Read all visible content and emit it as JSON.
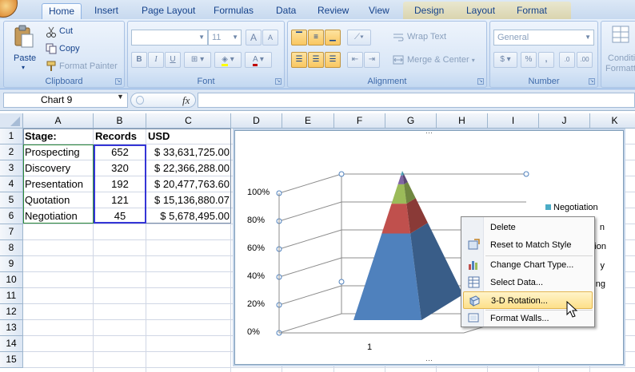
{
  "ribbon": {
    "tabs": [
      "Home",
      "Insert",
      "Page Layout",
      "Formulas",
      "Data",
      "Review",
      "View",
      "Design",
      "Layout",
      "Format"
    ],
    "clipboard": {
      "paste": "Paste",
      "cut": "Cut",
      "copy": "Copy",
      "format_painter": "Format Painter",
      "label": "Clipboard"
    },
    "font": {
      "size": "11",
      "label": "Font",
      "bold": "B",
      "italic": "I",
      "underline": "U",
      "grow": "A",
      "shrink": "A",
      "color_a": "A"
    },
    "alignment": {
      "wrap_text": "Wrap Text",
      "merge_center": "Merge & Center",
      "label": "Alignment"
    },
    "number": {
      "format": "General",
      "currency": "$",
      "percent": "%",
      "comma": ",",
      "label": "Number",
      "inc_dec": ".0",
      "dec_dec": ".00"
    },
    "styles": {
      "conditional": "Conditi",
      "format": "Formatt"
    }
  },
  "formula_bar": {
    "name_box": "Chart 9",
    "fx": "fx",
    "formula": ""
  },
  "columns": [
    "A",
    "B",
    "C",
    "D",
    "E",
    "F",
    "G",
    "H",
    "I",
    "J",
    "K"
  ],
  "rows": [
    "1",
    "2",
    "3",
    "4",
    "5",
    "6",
    "7",
    "8",
    "9",
    "10",
    "11",
    "12",
    "13",
    "14",
    "15"
  ],
  "table": {
    "headers": [
      "Stage:",
      "Records",
      "USD"
    ],
    "rows": [
      [
        "Prospecting",
        "652",
        "$ 33,631,725.00"
      ],
      [
        "Discovery",
        "320",
        "$ 22,366,288.00"
      ],
      [
        "Presentation",
        "192",
        "$ 20,477,763.60"
      ],
      [
        "Quotation",
        "121",
        "$ 15,136,880.07"
      ],
      [
        "Negotiation",
        "45",
        "$   5,678,495.00"
      ]
    ]
  },
  "chart_data": {
    "type": "bar",
    "subtype": "3d-pyramid-100-percent-stacked",
    "categories": [
      "1"
    ],
    "y_ticks": [
      "0%",
      "20%",
      "40%",
      "60%",
      "80%",
      "100%"
    ],
    "ylim": [
      0,
      100
    ],
    "series": [
      {
        "name": "Prospecting",
        "values": [
          0.58
        ],
        "color": "#4f81bd"
      },
      {
        "name": "Discovery",
        "values": [
          0.2
        ],
        "color": "#c0504d"
      },
      {
        "name": "Presentation",
        "values": [
          0.13
        ],
        "color": "#9bbb59"
      },
      {
        "name": "Quotation",
        "values": [
          0.06
        ],
        "color": "#8064a2"
      },
      {
        "name": "Negotiation",
        "values": [
          0.03
        ],
        "color": "#4bacc6"
      }
    ],
    "legend_position": "right",
    "legend_visible": [
      "Negotiation"
    ],
    "legend_partial": [
      "n",
      "ion",
      "y",
      "ng"
    ]
  },
  "context_menu": {
    "items": [
      {
        "label": "Delete",
        "icon": "delete-icon"
      },
      {
        "label": "Reset to Match Style",
        "icon": "reset-style-icon"
      },
      {
        "label": "Change Chart Type...",
        "icon": "chart-type-icon"
      },
      {
        "label": "Select Data...",
        "icon": "select-data-icon"
      },
      {
        "label": "3-D Rotation...",
        "icon": "rotation-icon"
      },
      {
        "label": "Format Walls...",
        "icon": "format-walls-icon"
      }
    ],
    "hovered_index": 4
  }
}
